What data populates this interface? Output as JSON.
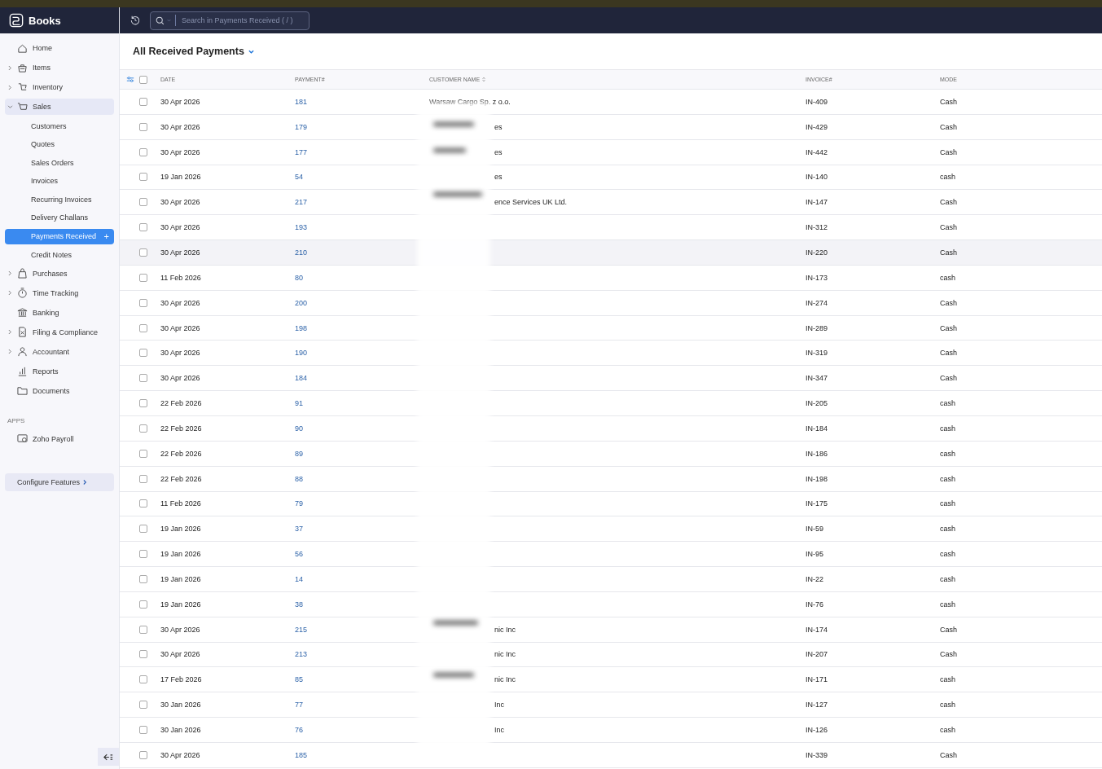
{
  "app": {
    "name": "Books"
  },
  "search": {
    "placeholder": "Search in Payments Received ( / )"
  },
  "sidebar": {
    "items": [
      {
        "label": "Home",
        "kind": "link",
        "selected": false
      },
      {
        "label": "Items",
        "kind": "group",
        "expanded": false,
        "selected": false
      },
      {
        "label": "Inventory",
        "kind": "group",
        "expanded": false,
        "selected": false
      },
      {
        "label": "Sales",
        "kind": "group",
        "expanded": true,
        "selected": true,
        "children": [
          {
            "label": "Customers",
            "selected": false
          },
          {
            "label": "Quotes",
            "selected": false
          },
          {
            "label": "Sales Orders",
            "selected": false
          },
          {
            "label": "Invoices",
            "selected": false
          },
          {
            "label": "Recurring Invoices",
            "selected": false
          },
          {
            "label": "Delivery Challans",
            "selected": false
          },
          {
            "label": "Payments Received",
            "selected": true,
            "add": "+"
          },
          {
            "label": "Credit Notes",
            "selected": false
          }
        ]
      },
      {
        "label": "Purchases",
        "kind": "group",
        "expanded": false,
        "selected": false
      },
      {
        "label": "Time Tracking",
        "kind": "group",
        "expanded": false,
        "selected": false
      },
      {
        "label": "Banking",
        "kind": "link",
        "selected": false
      },
      {
        "label": "Filing & Compliance",
        "kind": "group",
        "expanded": false,
        "selected": false
      },
      {
        "label": "Accountant",
        "kind": "group",
        "expanded": false,
        "selected": false
      },
      {
        "label": "Reports",
        "kind": "link",
        "selected": false
      },
      {
        "label": "Documents",
        "kind": "link",
        "selected": false
      }
    ],
    "apps_heading": "APPS",
    "apps": [
      {
        "label": "Zoho Payroll"
      }
    ],
    "configure": "Configure Features"
  },
  "view": {
    "title": "All Received Payments"
  },
  "table": {
    "select_all": {
      "checked": false
    },
    "columns": [
      "DATE",
      "PAYMENT#",
      "CUSTOMER NAME",
      "INVOICE#",
      "MODE"
    ],
    "rows": [
      {
        "date": "30 Apr 2026",
        "payment": "181",
        "customer": "Warsaw Cargo Sp. z o.o.",
        "redacted": false,
        "invoice": "IN-409",
        "mode": "Cash",
        "highlighted": false,
        "checked": false
      },
      {
        "date": "30 Apr 2026",
        "payment": "179",
        "customer": "es",
        "redacted": true,
        "invoice": "IN-429",
        "mode": "Cash",
        "highlighted": false,
        "checked": false
      },
      {
        "date": "30 Apr 2026",
        "payment": "177",
        "customer": "es",
        "redacted": true,
        "invoice": "IN-442",
        "mode": "Cash",
        "highlighted": false,
        "checked": false
      },
      {
        "date": "19 Jan 2026",
        "payment": "54",
        "customer": "es",
        "redacted": true,
        "invoice": "IN-140",
        "mode": "cash",
        "highlighted": false,
        "checked": false
      },
      {
        "date": "30 Apr 2026",
        "payment": "217",
        "customer": "ence Services UK Ltd.",
        "redacted": true,
        "invoice": "IN-147",
        "mode": "Cash",
        "highlighted": false,
        "checked": false
      },
      {
        "date": "30 Apr 2026",
        "payment": "193",
        "invoice": "IN-312",
        "mode": "Cash",
        "highlighted": false,
        "checked": false
      },
      {
        "date": "30 Apr 2026",
        "payment": "210",
        "invoice": "IN-220",
        "mode": "Cash",
        "highlighted": true,
        "checked": false
      },
      {
        "date": "11 Feb 2026",
        "payment": "80",
        "invoice": "IN-173",
        "mode": "cash",
        "highlighted": false,
        "checked": false
      },
      {
        "date": "30 Apr 2026",
        "payment": "200",
        "invoice": "IN-274",
        "mode": "Cash",
        "highlighted": false,
        "checked": false
      },
      {
        "date": "30 Apr 2026",
        "payment": "198",
        "invoice": "IN-289",
        "mode": "Cash",
        "highlighted": false,
        "checked": false
      },
      {
        "date": "30 Apr 2026",
        "payment": "190",
        "invoice": "IN-319",
        "mode": "Cash",
        "highlighted": false,
        "checked": false
      },
      {
        "date": "30 Apr 2026",
        "payment": "184",
        "invoice": "IN-347",
        "mode": "Cash",
        "highlighted": false,
        "checked": false
      },
      {
        "date": "22 Feb 2026",
        "payment": "91",
        "invoice": "IN-205",
        "mode": "cash",
        "highlighted": false,
        "checked": false
      },
      {
        "date": "22 Feb 2026",
        "payment": "90",
        "invoice": "IN-184",
        "mode": "cash",
        "highlighted": false,
        "checked": false
      },
      {
        "date": "22 Feb 2026",
        "payment": "89",
        "invoice": "IN-186",
        "mode": "cash",
        "highlighted": false,
        "checked": false
      },
      {
        "date": "22 Feb 2026",
        "payment": "88",
        "invoice": "IN-198",
        "mode": "cash",
        "highlighted": false,
        "checked": false
      },
      {
        "date": "11 Feb 2026",
        "payment": "79",
        "invoice": "IN-175",
        "mode": "cash",
        "highlighted": false,
        "checked": false
      },
      {
        "date": "19 Jan 2026",
        "payment": "37",
        "invoice": "IN-59",
        "mode": "cash",
        "highlighted": false,
        "checked": false
      },
      {
        "date": "19 Jan 2026",
        "payment": "56",
        "invoice": "IN-95",
        "mode": "cash",
        "highlighted": false,
        "checked": false
      },
      {
        "date": "19 Jan 2026",
        "payment": "14",
        "invoice": "IN-22",
        "mode": "cash",
        "highlighted": false,
        "checked": false
      },
      {
        "date": "19 Jan 2026",
        "payment": "38",
        "invoice": "IN-76",
        "mode": "cash",
        "highlighted": false,
        "checked": false
      },
      {
        "date": "30 Apr 2026",
        "payment": "215",
        "customer": "nic Inc",
        "redacted": true,
        "invoice": "IN-174",
        "mode": "Cash",
        "highlighted": false,
        "checked": false
      },
      {
        "date": "30 Apr 2026",
        "payment": "213",
        "customer": "nic Inc",
        "redacted": true,
        "invoice": "IN-207",
        "mode": "Cash",
        "highlighted": false,
        "checked": false
      },
      {
        "date": "17 Feb 2026",
        "payment": "85",
        "customer": "nic Inc",
        "redacted": true,
        "invoice": "IN-171",
        "mode": "cash",
        "highlighted": false,
        "checked": false
      },
      {
        "date": "30 Jan 2026",
        "payment": "77",
        "customer": "Inc",
        "redacted": true,
        "invoice": "IN-127",
        "mode": "cash",
        "highlighted": false,
        "checked": false
      },
      {
        "date": "30 Jan 2026",
        "payment": "76",
        "customer": "Inc",
        "redacted": true,
        "invoice": "IN-126",
        "mode": "cash",
        "highlighted": false,
        "checked": false
      },
      {
        "date": "30 Apr 2026",
        "payment": "185",
        "invoice": "IN-339",
        "mode": "Cash",
        "highlighted": false,
        "checked": false
      }
    ]
  }
}
